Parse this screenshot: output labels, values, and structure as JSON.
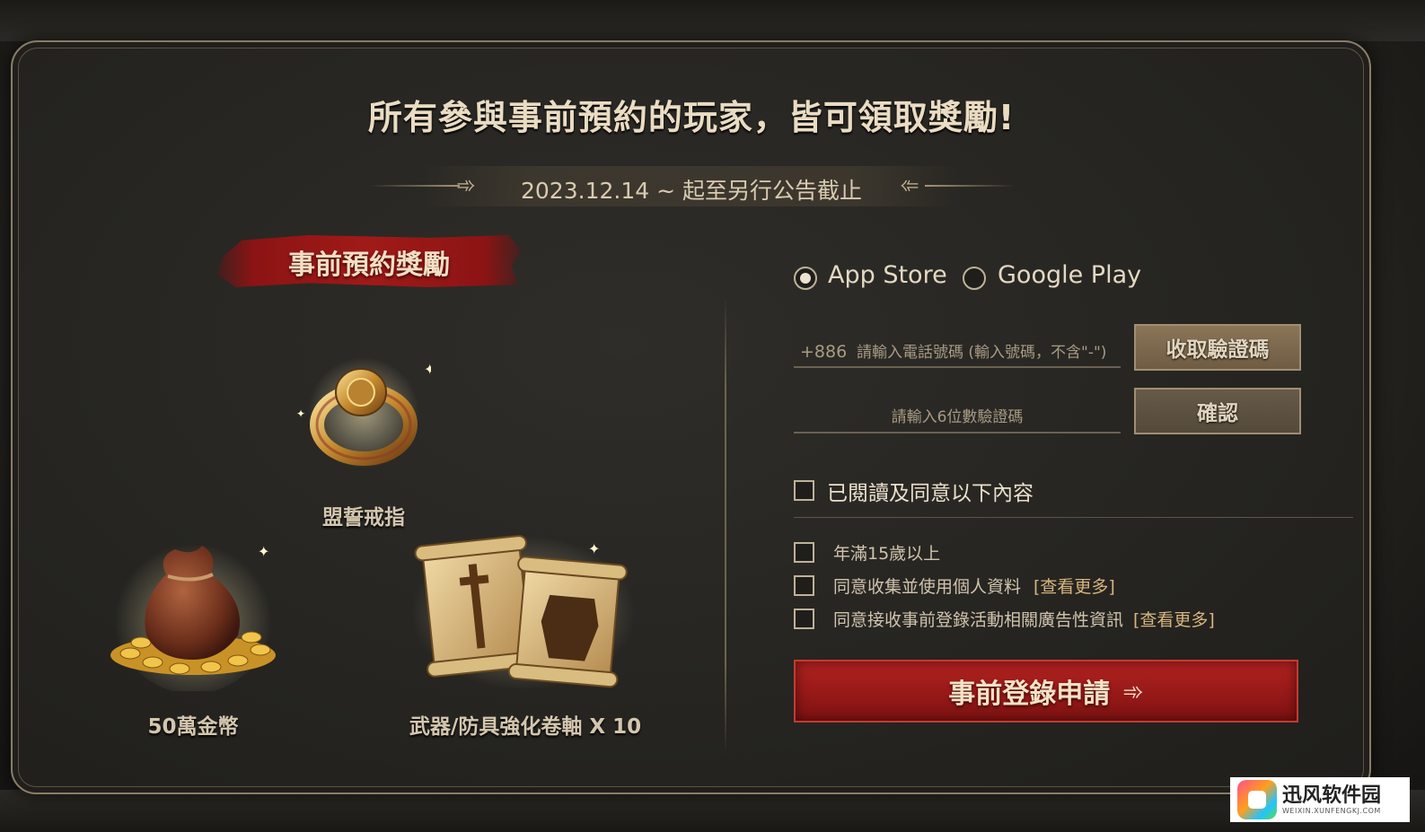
{
  "headline": "所有參與事前預約的玩家，皆可領取獎勵!",
  "date_range": "2023.12.14 ~ 起至另行公告截止",
  "rewards": {
    "title": "事前預約獎勵",
    "items": [
      {
        "label": "盟誓戒指",
        "icon": "ring-icon"
      },
      {
        "label": "50萬金幣",
        "icon": "gold-bag-icon"
      },
      {
        "label": "武器/防具強化卷軸 X 10",
        "icon": "scroll-icon"
      }
    ]
  },
  "form": {
    "platforms": [
      {
        "label": "App Store",
        "selected": true
      },
      {
        "label": "Google Play",
        "selected": false
      }
    ],
    "phone": {
      "prefix": "+886",
      "placeholder": "請輸入電話號碼 (輸入號碼，不含\"-\")"
    },
    "get_code_button": "收取驗證碼",
    "code": {
      "placeholder": "請輸入6位數驗證碼"
    },
    "confirm_button": "確認",
    "agree_all": "已閱讀及同意以下內容",
    "terms": [
      {
        "label": "年滿15歲以上",
        "more": ""
      },
      {
        "label": "同意收集並使用個人資料",
        "more": "[查看更多]"
      },
      {
        "label": "同意接收事前登錄活動相關廣告性資訊",
        "more": "[查看更多]"
      }
    ],
    "submit_button": "事前登錄申請"
  },
  "watermark": {
    "name": "迅风软件园",
    "url": "WEIXIN.XUNFENGKJ.COM"
  },
  "colors": {
    "accent_red": "#a01a18",
    "gold_text": "#d7b57d",
    "panel_bg": "#262521"
  }
}
